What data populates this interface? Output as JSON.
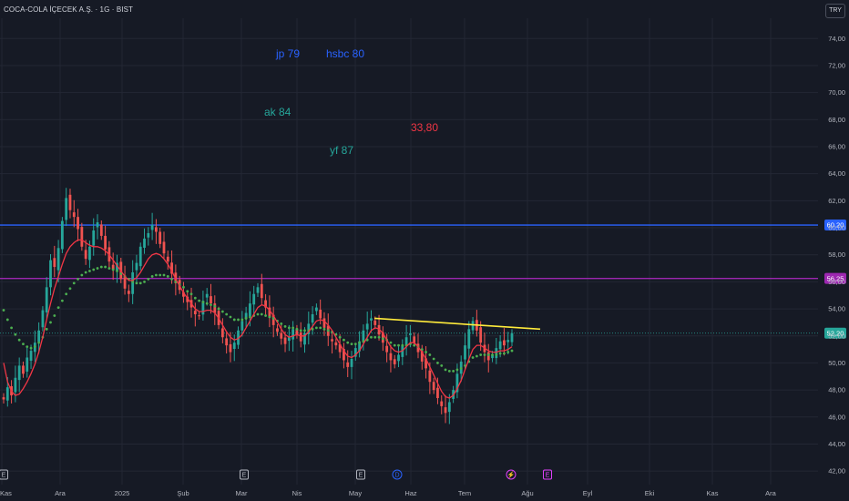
{
  "header": {
    "symbol_title": "COCA-COLA İÇECEK A.Ş. · 1G · BIST",
    "currency": "TRY"
  },
  "colors": {
    "background": "#161a25",
    "grid": "#232734",
    "up": "#26a69a",
    "down": "#ef5350",
    "ema": "#4caf50",
    "sma": "#f23645",
    "blue_line": "#2962ff",
    "purple_line": "#9c27b0",
    "trendline": "#ffeb3b",
    "last_price": "#26a69a"
  },
  "chart_data": {
    "type": "candlestick",
    "y_axis": {
      "min": 41,
      "max": 75.5,
      "position": "right",
      "ticks": [
        "42,00",
        "44,00",
        "46,00",
        "48,00",
        "50,00",
        "52,00",
        "54,00",
        "56,00",
        "58,00",
        "60,00",
        "62,00",
        "64,00",
        "66,00",
        "68,00",
        "70,00",
        "72,00",
        "74,00"
      ]
    },
    "x_axis": {
      "ticks": [
        "Kas",
        "Ara",
        "2025",
        "Şub",
        "Mar",
        "Nis",
        "May",
        "Haz",
        "Tem",
        "Ağu",
        "Eyl",
        "Eki",
        "Kas",
        "Ara"
      ]
    },
    "horizontal_lines": [
      {
        "name": "resistance-blue",
        "value": 60.2,
        "label": "60,20",
        "color": "#2962ff"
      },
      {
        "name": "resistance-purple",
        "value": 56.25,
        "label": "56,25",
        "color": "#9c27b0"
      }
    ],
    "last_price": {
      "value": 52.2,
      "label": "52,20"
    },
    "trendline": {
      "start": {
        "x": "May",
        "y": 53.3
      },
      "end": {
        "x": "Ağu",
        "y": 52.5
      },
      "color": "#ffeb3b"
    },
    "annotations": [
      {
        "text": "jp 79",
        "color": "#2962ff"
      },
      {
        "text": "hsbc 80",
        "color": "#2962ff"
      },
      {
        "text": "ak 84",
        "color": "#26a69a"
      },
      {
        "text": "33,80",
        "color": "#f23645"
      },
      {
        "text": "yf 87",
        "color": "#26a69a"
      }
    ],
    "event_markers": [
      {
        "symbol": "E",
        "color": "#b2b5be"
      },
      {
        "symbol": "E",
        "color": "#b2b5be"
      },
      {
        "symbol": "E",
        "color": "#b2b5be"
      },
      {
        "symbol": "D",
        "color": "#2962ff"
      },
      {
        "symbol": "⚡",
        "color": "#e040fb"
      },
      {
        "symbol": "E",
        "color": "#e040fb"
      }
    ],
    "candles_close": [
      47.3,
      48.2,
      47.6,
      48.9,
      49.8,
      49.2,
      50.4,
      50.9,
      51.5,
      52.4,
      53.9,
      55.6,
      57.6,
      57.1,
      58.5,
      60.5,
      62.2,
      61.3,
      60.8,
      59.9,
      58.6,
      57.7,
      58.6,
      59.8,
      60.4,
      59.4,
      58.4,
      57.5,
      56.9,
      57.4,
      56.2,
      55.5,
      55.1,
      56.7,
      57.4,
      58.6,
      59.2,
      59.6,
      60.2,
      59.7,
      58.8,
      58.1,
      57.5,
      56.6,
      55.9,
      55.4,
      54.9,
      54.5,
      54.1,
      53.6,
      53.5,
      54.6,
      55.1,
      54.4,
      53.7,
      52.8,
      51.9,
      51.3,
      50.8,
      51.5,
      52.4,
      53.1,
      53.7,
      54.4,
      55.1,
      55.6,
      54.8,
      54.1,
      53.4,
      52.8,
      52.3,
      51.8,
      51.4,
      51.9,
      52.5,
      52.1,
      51.6,
      52.2,
      52.9,
      53.6,
      54.1,
      53.3,
      52.6,
      52.0,
      51.6,
      51.3,
      50.8,
      50.2,
      49.7,
      50.3,
      51.1,
      51.6,
      52.4,
      52.9,
      53.3,
      52.8,
      52.1,
      51.5,
      50.8,
      50.2,
      49.9,
      50.6,
      51.3,
      51.9,
      52.2,
      51.5,
      50.8,
      50.1,
      49.6,
      48.6,
      48.0,
      47.4,
      46.8,
      46.3,
      47.1,
      48.0,
      49.2,
      50.1,
      51.3,
      52.5,
      53.1,
      52.4,
      51.5,
      50.8,
      50.2,
      50.6,
      51.1,
      51.6,
      51.3,
      51.7,
      52.2
    ],
    "ema_series": [
      53.9,
      53.2,
      52.6,
      52.1,
      51.7,
      51.4,
      51.2,
      51.1,
      51.2,
      51.5,
      51.9,
      52.5,
      53.0,
      53.5,
      54.1,
      54.6,
      55.1,
      55.5,
      55.9,
      56.2,
      56.5,
      56.7,
      56.8,
      56.9,
      57.0,
      57.1,
      57.1,
      57.0,
      56.9,
      56.8,
      56.6,
      56.4,
      56.2,
      56.0,
      55.9,
      55.9,
      56.0,
      56.2,
      56.4,
      56.5,
      56.5,
      56.5,
      56.4,
      56.2,
      56.0,
      55.8,
      55.6,
      55.3,
      55.1,
      54.8,
      54.6,
      54.5,
      54.4,
      54.3,
      54.2,
      54.0,
      53.8,
      53.6,
      53.4,
      53.2,
      53.2,
      53.2,
      53.3,
      53.4,
      53.5,
      53.6,
      53.6,
      53.5,
      53.4,
      53.3,
      53.1,
      52.9,
      52.7,
      52.6,
      52.6,
      52.5,
      52.4,
      52.4,
      52.4,
      52.5,
      52.6,
      52.6,
      52.5,
      52.4,
      52.3,
      52.1,
      51.9,
      51.7,
      51.5,
      51.4,
      51.4,
      51.5,
      51.6,
      51.7,
      51.9,
      51.9,
      51.9,
      51.8,
      51.7,
      51.5,
      51.3,
      51.3,
      51.3,
      51.3,
      51.4,
      51.3,
      51.2,
      51.0,
      50.8,
      50.6,
      50.3,
      50.0,
      49.8,
      49.5,
      49.4,
      49.4,
      49.5,
      49.6,
      49.8,
      50.1,
      50.4,
      50.5,
      50.6,
      50.6,
      50.6,
      50.6,
      50.6,
      50.7,
      50.7,
      50.8,
      50.9
    ],
    "sma_series": [
      50.0,
      48.6,
      47.9,
      47.6,
      47.7,
      48.1,
      48.6,
      49.2,
      49.9,
      50.8,
      51.9,
      53.2,
      54.4,
      55.5,
      56.4,
      57.3,
      58.1,
      58.6,
      58.9,
      59.1,
      59.1,
      58.9,
      58.7,
      58.6,
      58.6,
      58.5,
      58.3,
      58.0,
      57.6,
      57.2,
      56.8,
      56.4,
      56.1,
      56.1,
      56.3,
      56.7,
      57.2,
      57.7,
      58.0,
      58.1,
      58.0,
      57.7,
      57.3,
      56.8,
      56.2,
      55.7,
      55.2,
      54.8,
      54.4,
      54.0,
      53.8,
      53.8,
      53.9,
      53.9,
      53.7,
      53.3,
      52.8,
      52.3,
      51.9,
      51.7,
      51.8,
      52.1,
      52.6,
      53.1,
      53.6,
      54.1,
      54.3,
      54.2,
      53.9,
      53.5,
      53.0,
      52.5,
      52.1,
      51.9,
      52.0,
      52.1,
      52.0,
      52.0,
      52.3,
      52.7,
      53.1,
      53.2,
      53.1,
      52.8,
      52.4,
      51.9,
      51.4,
      50.9,
      50.5,
      50.4,
      50.6,
      50.9,
      51.4,
      51.9,
      52.4,
      52.6,
      52.5,
      52.2,
      51.7,
      51.2,
      50.9,
      50.8,
      50.9,
      51.2,
      51.5,
      51.5,
      51.2,
      50.8,
      50.3,
      49.7,
      49.1,
      48.5,
      47.9,
      47.5,
      47.4,
      47.6,
      48.1,
      48.7,
      49.5,
      50.3,
      51.0,
      51.3,
      51.3,
      51.1,
      50.9,
      50.8,
      50.8,
      50.9,
      50.9,
      51.0,
      51.2
    ]
  }
}
